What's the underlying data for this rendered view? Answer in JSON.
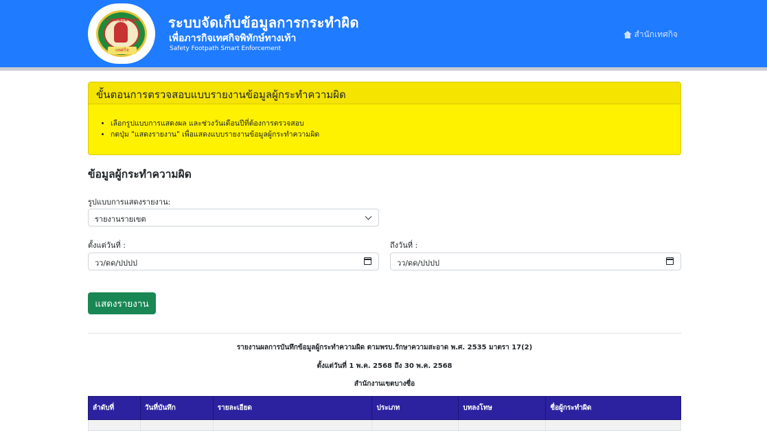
{
  "header": {
    "logo_text_top": "กรุงเทพมหานคร",
    "logo_text_bottom": "เทศกิจ",
    "title": "ระบบจัดเก็บข้อมูลการกระทำผิด",
    "subtitle": "เพื่อภารกิจเทศกิจพิทักษ์ทางเท้า",
    "tagline": "Safety Footpath Smart Enforcement",
    "nav_label": "สำนักเทศกิจ",
    "nav_icon": "home-icon"
  },
  "instructions": {
    "heading": "ขั้นตอนการตรวจสอบแบบรายงานข้อมูลผู้กระทำความผิด",
    "items": [
      "เลือกรูปแบบการแสดงผล และช่วงวันเดือนปีที่ต้องการตรวจสอบ",
      "กดปุ่ม \"แสดงรายงาน\" เพื่อแสดงแบบรายงานข้อมูลผู้กระทำความผิด"
    ]
  },
  "form": {
    "section_title": "ข้อมูลผู้กระทำความผิด",
    "report_type_label": "รูปแบบการแสดงรายงาน:",
    "report_type_value": "รายงานรายเขต",
    "from_label": "ตั้งแต่วันที่ :",
    "from_value": "วว/ดด/ปปปป",
    "to_label": "ถึงวันที่ :",
    "to_value": "วว/ดด/ปปปป",
    "submit_label": "แสดงรายงาน"
  },
  "report": {
    "title": "รายงานผลการบันทึกข้อมูลผู้กระทำความผิด ตามพรบ.รักษาความสะอาด พ.ศ. 2535 มาตรา 17(2)",
    "date_range": "ตั้งแต่วันที่ 1 พ.ค. 2568 ถึง 30 พ.ค. 2568",
    "office": "สำนักงานเขตบางซื่อ",
    "columns": [
      "ลำดับที่",
      "วันที่บันทึก",
      "รายละเอียด",
      "ประเภท",
      "บทลงโทษ",
      "ชื่อผู้กระทำผิด"
    ],
    "rows": [
      [
        "",
        "",
        "",
        "",
        "",
        ""
      ]
    ]
  },
  "colors": {
    "header_bg": "#1f7bff",
    "panel_bg": "#fff200",
    "button_bg": "#198754",
    "table_header_bg": "#2c22a0"
  }
}
